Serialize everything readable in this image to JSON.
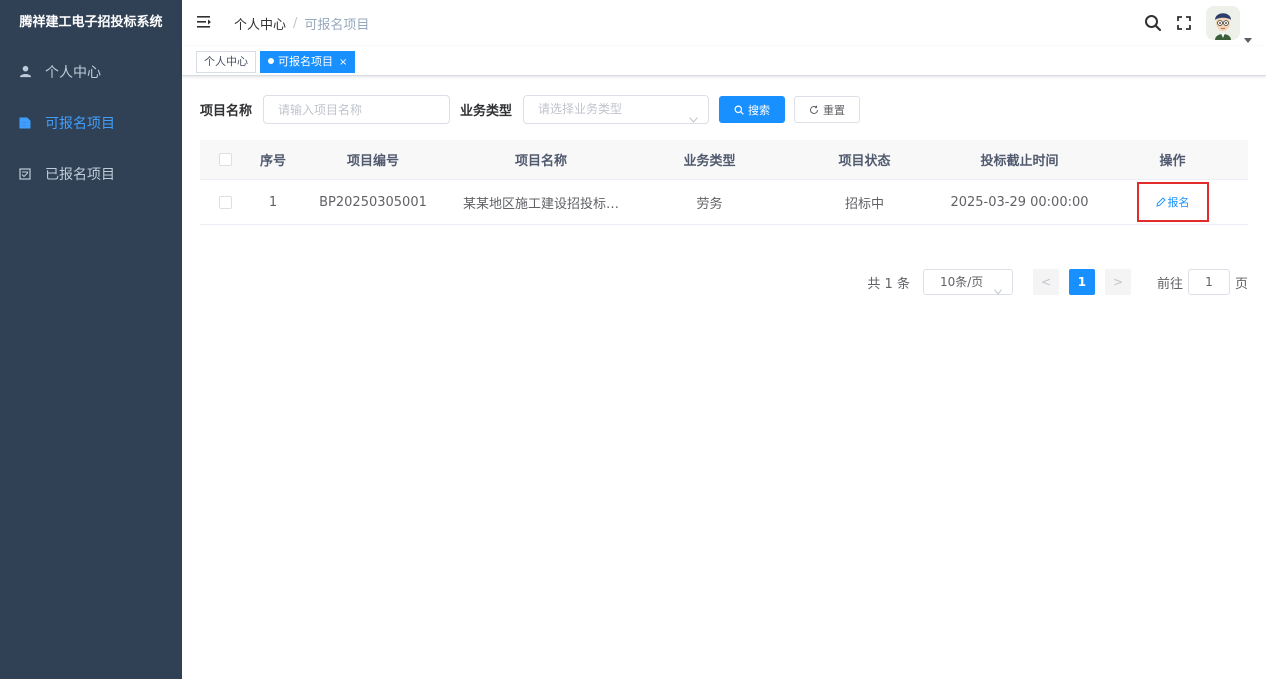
{
  "app": {
    "title": "腾祥建工电子招投标系统"
  },
  "sidebar": {
    "items": [
      {
        "label": "个人中心",
        "icon": "user-icon",
        "active": false
      },
      {
        "label": "可报名项目",
        "icon": "document-icon",
        "active": true
      },
      {
        "label": "已报名项目",
        "icon": "checklist-icon",
        "active": false
      }
    ]
  },
  "header": {
    "breadcrumb": [
      "个人中心",
      "可报名项目"
    ],
    "breadcrumb_separator": "/",
    "icons": [
      "hamburger-icon",
      "search-icon",
      "fullscreen-icon",
      "avatar",
      "caret-down-icon"
    ]
  },
  "tags": [
    {
      "label": "个人中心",
      "active": false
    },
    {
      "label": "可报名项目",
      "active": true,
      "close": "×"
    }
  ],
  "search": {
    "name_label": "项目名称",
    "name_placeholder": "请输入项目名称",
    "type_label": "业务类型",
    "type_placeholder": "请选择业务类型",
    "search_button": "搜索",
    "reset_button": "重置"
  },
  "table": {
    "columns": [
      "序号",
      "项目编号",
      "项目名称",
      "业务类型",
      "项目状态",
      "投标截止时间",
      "操作"
    ],
    "rows": [
      {
        "index": "1",
        "code": "BP20250305001",
        "name": "某某地区施工建设招投标…",
        "type": "劳务",
        "status": "招标中",
        "deadline": "2025-03-29 00:00:00",
        "action": "报名"
      }
    ]
  },
  "pagination": {
    "total": "共 1 条",
    "page_size": "10条/页",
    "prev": "<",
    "current_page": "1",
    "next": ">",
    "goto_label": "前往",
    "goto_value": "1",
    "goto_unit": "页"
  },
  "colors": {
    "sidebar_bg": "#304156",
    "primary": "#1890ff",
    "highlight_border": "#e22b2b"
  }
}
